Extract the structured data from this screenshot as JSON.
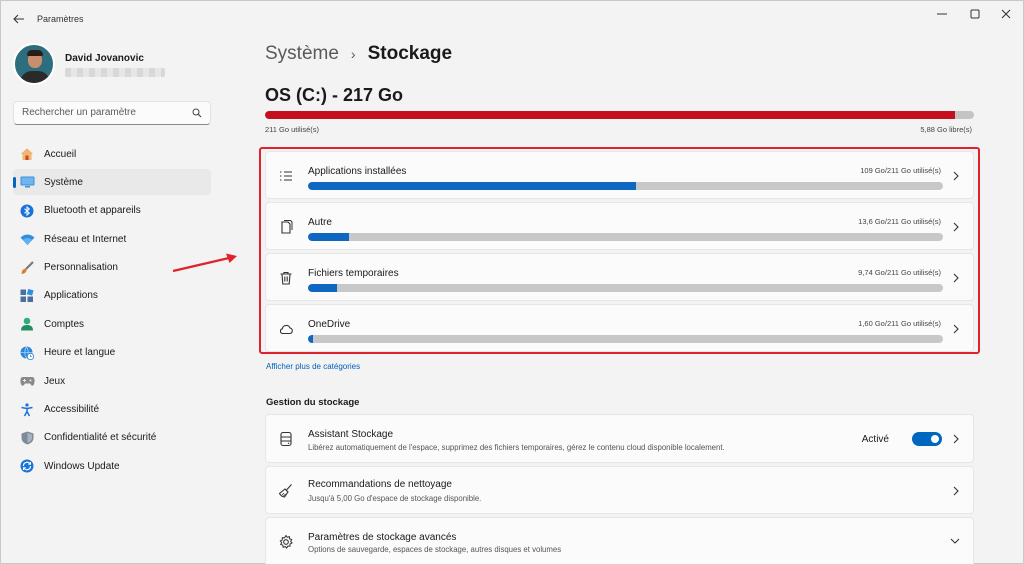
{
  "app": {
    "title": "Paramètres"
  },
  "user": {
    "name": "David Jovanovic"
  },
  "search": {
    "placeholder": "Rechercher un paramètre"
  },
  "nav": {
    "items": [
      {
        "label": "Accueil",
        "icon": "home-icon",
        "active": false
      },
      {
        "label": "Système",
        "icon": "system-icon",
        "active": true
      },
      {
        "label": "Bluetooth et appareils",
        "icon": "bluetooth-icon",
        "active": false
      },
      {
        "label": "Réseau et Internet",
        "icon": "wifi-icon",
        "active": false
      },
      {
        "label": "Personnalisation",
        "icon": "brush-icon",
        "active": false
      },
      {
        "label": "Applications",
        "icon": "apps-icon",
        "active": false
      },
      {
        "label": "Comptes",
        "icon": "account-icon",
        "active": false
      },
      {
        "label": "Heure et langue",
        "icon": "globe-clock-icon",
        "active": false
      },
      {
        "label": "Jeux",
        "icon": "gamepad-icon",
        "active": false
      },
      {
        "label": "Accessibilité",
        "icon": "accessibility-icon",
        "active": false
      },
      {
        "label": "Confidentialité et sécurité",
        "icon": "shield-icon",
        "active": false
      },
      {
        "label": "Windows Update",
        "icon": "update-icon",
        "active": false
      }
    ]
  },
  "breadcrumb": {
    "parent": "Système",
    "separator": "›",
    "current": "Stockage"
  },
  "drive": {
    "title": "OS (C:) - 217 Go",
    "used_label": "211 Go utilisé(s)",
    "free_label": "5,88 Go libre(s)",
    "used_fraction": 0.973,
    "bar_color": "#c50f1f"
  },
  "categories": [
    {
      "name": "Applications installées",
      "usage": "109 Go/211 Go utilisé(s)",
      "fraction": 0.517,
      "icon": "list-icon"
    },
    {
      "name": "Autre",
      "usage": "13,6 Go/211 Go utilisé(s)",
      "fraction": 0.064,
      "icon": "document-icon"
    },
    {
      "name": "Fichiers temporaires",
      "usage": "9,74 Go/211 Go utilisé(s)",
      "fraction": 0.046,
      "icon": "trash-icon"
    },
    {
      "name": "OneDrive",
      "usage": "1,60 Go/211 Go utilisé(s)",
      "fraction": 0.008,
      "icon": "cloud-icon"
    }
  ],
  "more_categories": "Afficher plus de catégories",
  "management": {
    "title": "Gestion du stockage",
    "items": [
      {
        "title": "Assistant Stockage",
        "desc": "Libérez automatiquement de l'espace, supprimez des fichiers temporaires, gérez le contenu cloud disponible localement.",
        "toggle_label": "Activé",
        "toggle_on": true,
        "icon": "storage-sense-icon"
      },
      {
        "title": "Recommandations de nettoyage",
        "desc": "Jusqu'à 5,00 Go d'espace de stockage disponible.",
        "icon": "broom-icon"
      },
      {
        "title": "Paramètres de stockage avancés",
        "desc": "Options de sauvegarde, espaces de stockage, autres disques et volumes",
        "icon": "gear-icon"
      }
    ]
  },
  "colors": {
    "accent": "#0067c0",
    "highlight_box": "#e0222c",
    "bar_fill": "#0e67c0",
    "bar_track": "#c8c8c8"
  }
}
